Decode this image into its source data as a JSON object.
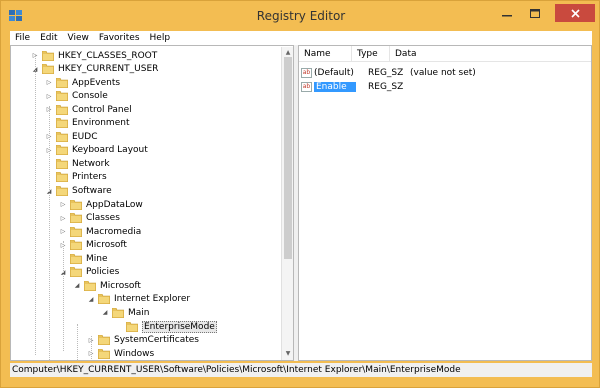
{
  "window": {
    "title": "Registry Editor"
  },
  "menu": [
    "File",
    "Edit",
    "View",
    "Favorites",
    "Help"
  ],
  "tree": [
    {
      "label": "HKEY_CLASSES_ROOT",
      "level": 0,
      "state": "collapsed"
    },
    {
      "label": "HKEY_CURRENT_USER",
      "level": 0,
      "state": "expanded"
    },
    {
      "label": "AppEvents",
      "level": 1,
      "state": "collapsed"
    },
    {
      "label": "Console",
      "level": 1,
      "state": "collapsed"
    },
    {
      "label": "Control Panel",
      "level": 1,
      "state": "collapsed"
    },
    {
      "label": "Environment",
      "level": 1,
      "state": "none"
    },
    {
      "label": "EUDC",
      "level": 1,
      "state": "collapsed"
    },
    {
      "label": "Keyboard Layout",
      "level": 1,
      "state": "collapsed"
    },
    {
      "label": "Network",
      "level": 1,
      "state": "none"
    },
    {
      "label": "Printers",
      "level": 1,
      "state": "none"
    },
    {
      "label": "Software",
      "level": 1,
      "state": "expanded"
    },
    {
      "label": "AppDataLow",
      "level": 2,
      "state": "collapsed"
    },
    {
      "label": "Classes",
      "level": 2,
      "state": "collapsed"
    },
    {
      "label": "Macromedia",
      "level": 2,
      "state": "collapsed"
    },
    {
      "label": "Microsoft",
      "level": 2,
      "state": "collapsed"
    },
    {
      "label": "Mine",
      "level": 2,
      "state": "none"
    },
    {
      "label": "Policies",
      "level": 2,
      "state": "expanded"
    },
    {
      "label": "Microsoft",
      "level": 3,
      "state": "expanded"
    },
    {
      "label": "Internet Explorer",
      "level": 4,
      "state": "expanded"
    },
    {
      "label": "Main",
      "level": 5,
      "state": "expanded"
    },
    {
      "label": "EnterpriseMode",
      "level": 6,
      "state": "none",
      "selected": true
    },
    {
      "label": "SystemCertificates",
      "level": 4,
      "state": "collapsed"
    },
    {
      "label": "Windows",
      "level": 4,
      "state": "collapsed"
    }
  ],
  "columns": {
    "name": "Name",
    "type": "Type",
    "data": "Data"
  },
  "values": [
    {
      "name": "(Default)",
      "type": "REG_SZ",
      "data": "(value not set)",
      "selected": false
    },
    {
      "name": "Enable",
      "type": "REG_SZ",
      "data": "",
      "selected": true
    }
  ],
  "status": "Computer\\HKEY_CURRENT_USER\\Software\\Policies\\Microsoft\\Internet Explorer\\Main\\EnterpriseMode"
}
